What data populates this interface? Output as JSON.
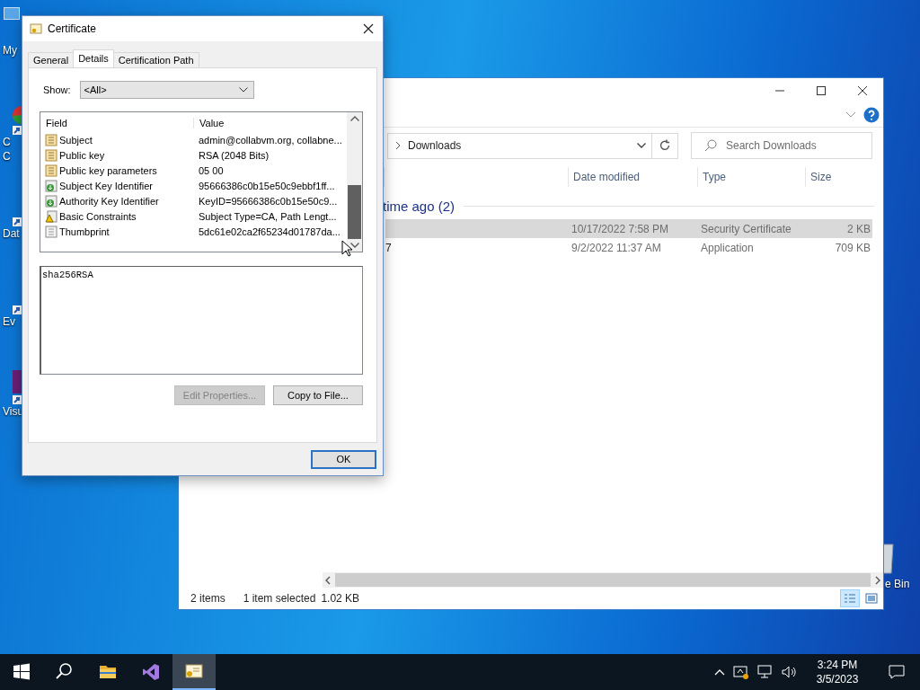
{
  "desktop_icons": [
    {
      "lines": [
        "My"
      ],
      "kind": "computer"
    },
    {
      "lines": [
        "C",
        "C"
      ],
      "kind": "browser"
    },
    {
      "lines": [
        "Dat"
      ],
      "kind": "shortcut"
    },
    {
      "lines": [
        "Ev"
      ],
      "kind": "shortcut"
    },
    {
      "lines": [
        "Visu"
      ],
      "kind": "studio"
    }
  ],
  "recycle_bin": {
    "label": "e Bin"
  },
  "explorer": {
    "address": "Downloads",
    "search": {
      "placeholder": "Search Downloads"
    },
    "columns": [
      "Date modified",
      "Type",
      "Size"
    ],
    "group": "time ago (2)",
    "rows": [
      {
        "name": "",
        "date": "10/17/2022 7:58 PM",
        "type": "Security Certificate",
        "size": "2 KB",
        "selected": true
      },
      {
        "name": "7",
        "date": "9/2/2022 11:37 AM",
        "type": "Application",
        "size": "709 KB",
        "selected": false
      }
    ],
    "status": [
      "2 items",
      "1 item selected",
      "1.02 KB"
    ],
    "views": [
      {
        "kind": "details",
        "selected": true
      },
      {
        "kind": "thumbnails",
        "selected": false
      }
    ]
  },
  "certificate_dialog": {
    "title": "Certificate",
    "tabs": [
      {
        "label": "General",
        "selected": false
      },
      {
        "label": "Details",
        "selected": true
      },
      {
        "label": "Certification Path",
        "selected": false
      }
    ],
    "show_label": "Show:",
    "show_value": "<All>",
    "columns": [
      "Field",
      "Value"
    ],
    "rows": [
      {
        "field": "Subject",
        "value": "admin@collabvm.org, collabne...",
        "kind": "property"
      },
      {
        "field": "Public key",
        "value": "RSA (2048 Bits)",
        "kind": "property"
      },
      {
        "field": "Public key parameters",
        "value": "05 00",
        "kind": "property"
      },
      {
        "field": "Subject Key Identifier",
        "value": "95666386c0b15e50c9ebbf1ff...",
        "kind": "extension"
      },
      {
        "field": "Authority Key Identifier",
        "value": "KeyID=95666386c0b15e50c9...",
        "kind": "extension"
      },
      {
        "field": "Basic Constraints",
        "value": "Subject Type=CA, Path Lengt...",
        "kind": "critical"
      },
      {
        "field": "Thumbprint",
        "value": "5dc61e02ca2f65234d01787da...",
        "kind": "plain"
      }
    ],
    "detail_text": "sha256RSA",
    "buttons": [
      {
        "label": "Edit Properties...",
        "disabled": true
      },
      {
        "label": "Copy to File...",
        "disabled": false
      }
    ],
    "ok": "OK"
  },
  "taskbar": {
    "items": [
      {
        "kind": "start",
        "active": false
      },
      {
        "kind": "search",
        "active": false
      },
      {
        "kind": "folder",
        "active": false
      },
      {
        "kind": "studio",
        "active": false
      },
      {
        "kind": "certificate",
        "active": true
      }
    ],
    "time": "3:24 PM",
    "date": "3/5/2023"
  }
}
